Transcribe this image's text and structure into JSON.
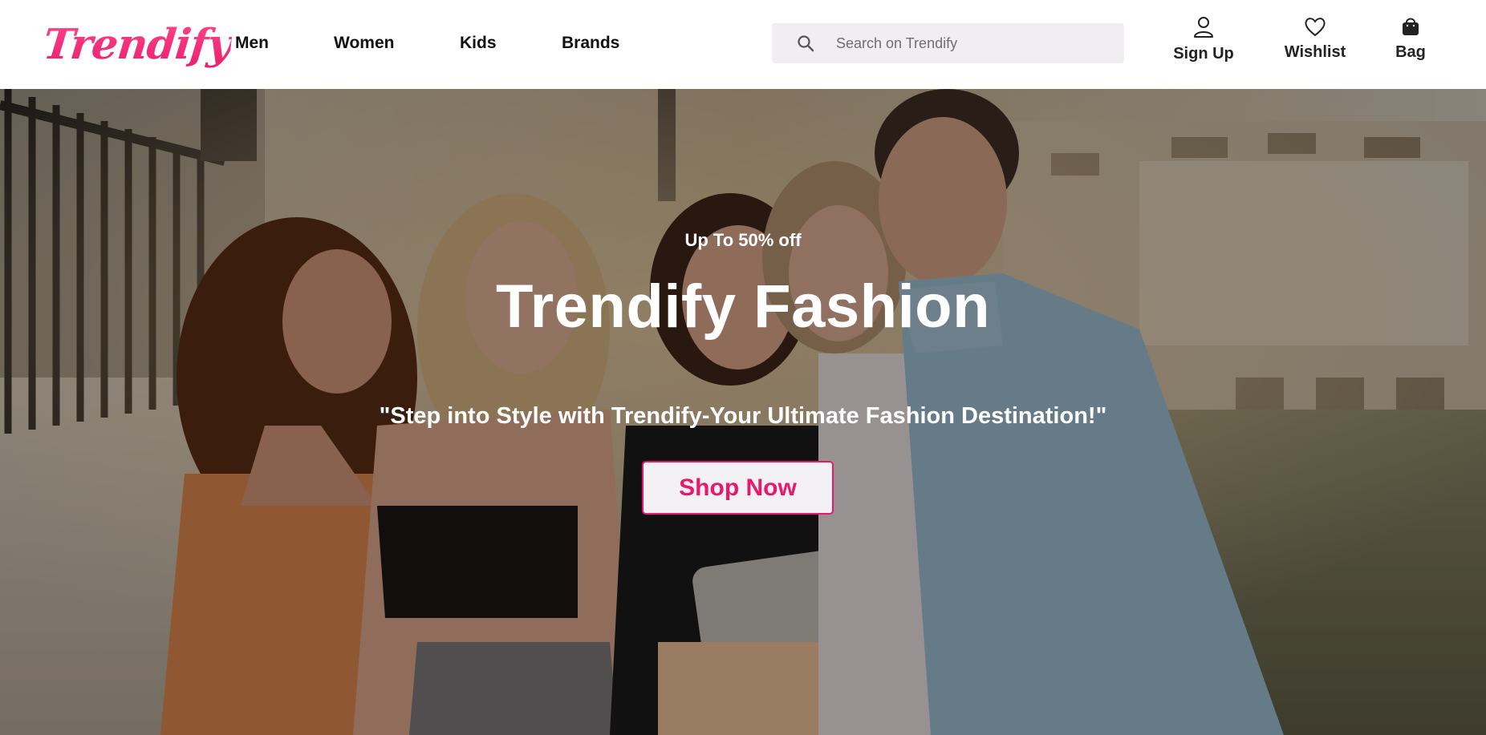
{
  "brand": {
    "logo_text": "Trendify",
    "accent_color": "#e8186a"
  },
  "nav": {
    "items": [
      {
        "label": "Men"
      },
      {
        "label": "Women"
      },
      {
        "label": "Kids"
      },
      {
        "label": "Brands"
      }
    ]
  },
  "search": {
    "placeholder": "Search on Trendify",
    "value": "",
    "icon": "search-icon"
  },
  "actions": {
    "signup": {
      "label": "Sign Up",
      "icon": "user-icon"
    },
    "wishlist": {
      "label": "Wishlist",
      "icon": "heart-icon"
    },
    "bag": {
      "label": "Bag",
      "icon": "shopping-bag-icon"
    }
  },
  "hero": {
    "offer": "Up To 50% off",
    "title": "Trendify Fashion",
    "tagline": "\"Step into Style with Trendify-Your Ultimate Fashion Destination!\"",
    "cta_label": "Shop Now",
    "image": "group-of-friends-looking-at-tablet-photo"
  }
}
